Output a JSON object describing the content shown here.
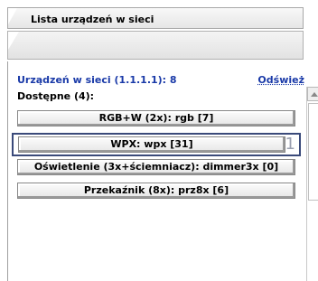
{
  "header": {
    "title": "Lista urządzeń w sieci"
  },
  "panel": {
    "devices_label": "Urządzeń w sieci (1.1.1.1): 8",
    "refresh_label": "Odśwież",
    "available_label": "Dostępne (4):",
    "devices": [
      {
        "label": "RGB+W (2x): rgb [7]",
        "selected": false
      },
      {
        "label": "WPX: wpx [31]",
        "selected": true,
        "badge": "1"
      },
      {
        "label": "Oświetlenie (3x+ściemniacz): dimmer3x [0]",
        "selected": false
      },
      {
        "label": "Przekaźnik (8x): prz8x [6]",
        "selected": false
      }
    ]
  }
}
